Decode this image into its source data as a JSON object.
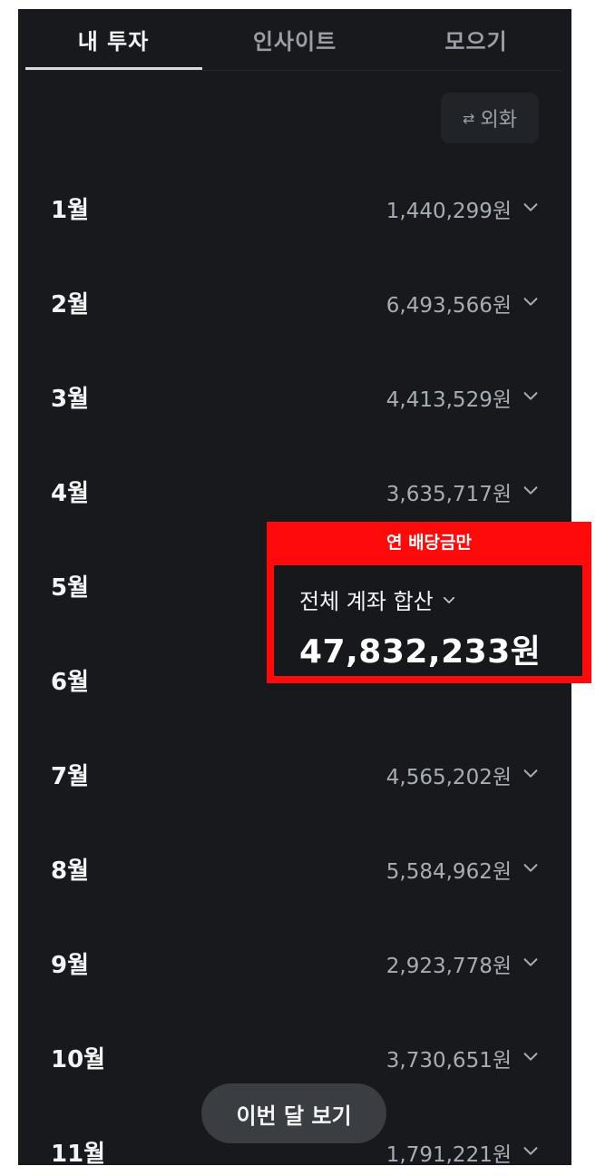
{
  "tabs": [
    "내 투자",
    "인사이트",
    "모으기"
  ],
  "fx_button": {
    "label": "외화",
    "icon": "swap-arrows-icon"
  },
  "months": [
    {
      "label": "1월",
      "amount": "1,440,299원"
    },
    {
      "label": "2월",
      "amount": "6,493,566원"
    },
    {
      "label": "3월",
      "amount": "4,413,529원"
    },
    {
      "label": "4월",
      "amount": "3,635,717원"
    },
    {
      "label": "5월",
      "amount": ""
    },
    {
      "label": "6월",
      "amount": ""
    },
    {
      "label": "7월",
      "amount": "4,565,202원"
    },
    {
      "label": "8월",
      "amount": "5,584,962원"
    },
    {
      "label": "9월",
      "amount": "2,923,778원"
    },
    {
      "label": "10월",
      "amount": "3,730,651원"
    },
    {
      "label": "11월",
      "amount": "1,791,221원"
    }
  ],
  "summary": {
    "header": "연 배당금만",
    "label": "전체 계좌 합산",
    "value": "47,832,233원"
  },
  "floating_button": {
    "label": "이번 달 보기"
  },
  "colors": {
    "background": "#17191c",
    "highlight_box": "#ff0a0a",
    "pill": "#3a3d42"
  }
}
